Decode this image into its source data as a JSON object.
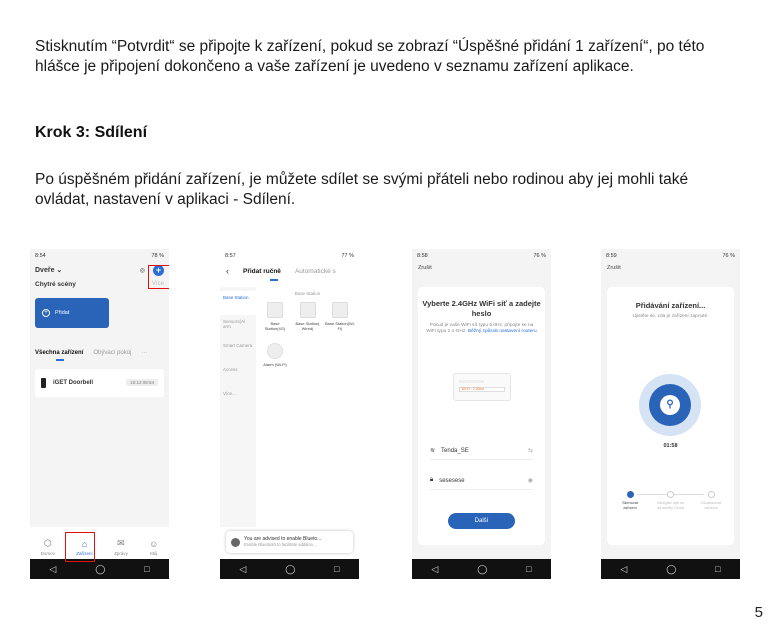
{
  "paragraph1": "Stisknutím “Potvrdit“ se připojte k zařízení, pokud se zobrazí “Úspěšné přidání 1 zařízení“, po této hlášce je připojení dokončeno a vaše zařízení je uvedeno v seznamu zařízení aplikace.",
  "heading": "Krok 3: Sdílení",
  "paragraph2": "Po úspěšném přidání zařízení, je můžete sdílet se svými přáteli nebo rodinou aby jej mohli také ovládat, nastavení v aplikaci - Sdílení.",
  "page_number": "5",
  "phone1": {
    "time": "8:54",
    "battery": "78 %",
    "home_title": "Dveře ⌄",
    "scenes_label": "Chytré scény",
    "scenes_more": "Více",
    "scene_card": "Přidat",
    "tab_all": "Všechna zařízení",
    "tab_room": "Obývací pokoj",
    "device_name": "iGET Doorbell",
    "device_time": "10:13 08:54",
    "nav": [
      "Domov",
      "Zařízení",
      "Zprávy",
      "Můj"
    ]
  },
  "phone2": {
    "time": "8:57",
    "battery": "77 %",
    "tab_manual": "Přidat ručně",
    "tab_auto": "Automatické s",
    "sidebar": [
      "Base Station",
      "Sensors(Al arm",
      "Smart Camera",
      "Access",
      "Více..."
    ],
    "section": "Base Station",
    "items": [
      "Base Station(4G)",
      "Base Station( Wired)",
      "Base Station(Wi-Fi)"
    ],
    "alarm": "Alarm (Wi-Fi)",
    "bt_title": "You are advised to enable Blueto...",
    "bt_sub": "Enable Bluetooth to facilitate addition ..."
  },
  "phone3": {
    "time": "8:58",
    "battery": "76 %",
    "cancel": "Zrušit",
    "title": "Vyberte 2.4GHz WiFi síť a zadejte heslo",
    "subtitle": "Pokud je vaše WiFi síť typu 5.0Hz, připojte se na WiFi typu 2.4 GHz.",
    "subtitle_link": "Běžný způsob nastavení routeru",
    "router_label": "Wi-Fi - 2.4Ghz",
    "wifi_name": "Tenda_SE",
    "password": "sesesese",
    "button": "Další"
  },
  "phone4": {
    "time": "8:59",
    "battery": "76 %",
    "cancel": "Zrušit",
    "title": "Přidávání zařízení...",
    "subtitle": "Ujistěte se, zda je zařízení zapnuté.",
    "timer": "01:58",
    "steps": [
      "Skenovat zařízení",
      "Zaregistr ujte se do služby Cloud",
      "Inicializovat zařízení"
    ]
  }
}
